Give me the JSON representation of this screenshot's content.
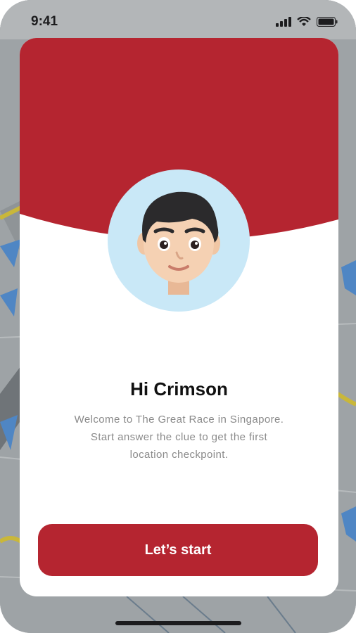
{
  "status_bar": {
    "time": "9:41",
    "icons": [
      "signal-icon",
      "wifi-icon",
      "battery-icon"
    ]
  },
  "colors": {
    "brand": "#b52530",
    "avatar_bg": "#c9e8f7",
    "card_bg": "#ffffff",
    "map_bg": "#9ea3a6"
  },
  "welcome": {
    "greeting": "Hi Crimson",
    "line1": "Welcome to The Great Race in Singapore.",
    "line2": "Start answer the clue to get the first",
    "line3": "location checkpoint.",
    "start_label": "Let’s start"
  },
  "avatar": {
    "icon": "memoji-avatar-icon"
  }
}
